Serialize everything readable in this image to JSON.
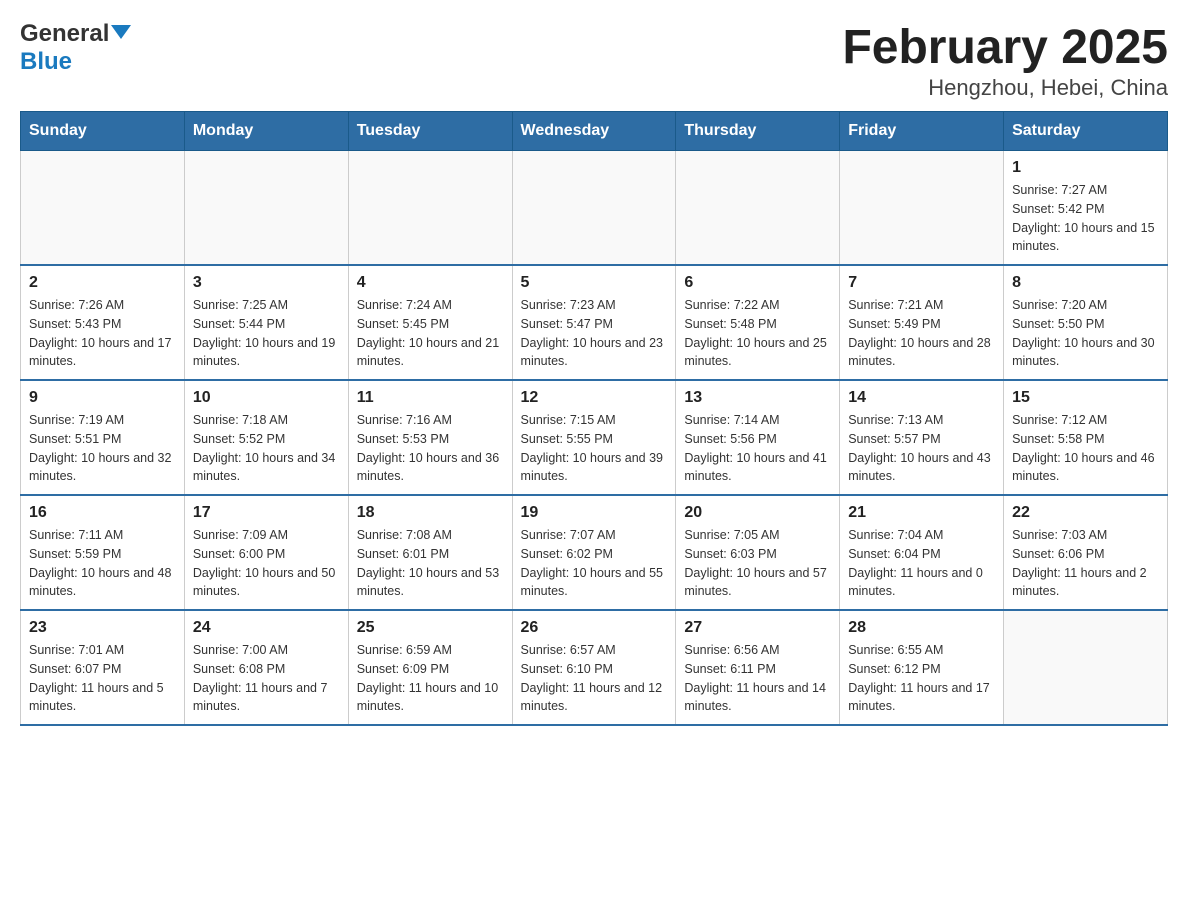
{
  "header": {
    "logo_general": "General",
    "logo_blue": "Blue",
    "month_title": "February 2025",
    "location": "Hengzhou, Hebei, China"
  },
  "weekdays": [
    "Sunday",
    "Monday",
    "Tuesday",
    "Wednesday",
    "Thursday",
    "Friday",
    "Saturday"
  ],
  "weeks": [
    [
      {
        "day": "",
        "info": ""
      },
      {
        "day": "",
        "info": ""
      },
      {
        "day": "",
        "info": ""
      },
      {
        "day": "",
        "info": ""
      },
      {
        "day": "",
        "info": ""
      },
      {
        "day": "",
        "info": ""
      },
      {
        "day": "1",
        "info": "Sunrise: 7:27 AM\nSunset: 5:42 PM\nDaylight: 10 hours and 15 minutes."
      }
    ],
    [
      {
        "day": "2",
        "info": "Sunrise: 7:26 AM\nSunset: 5:43 PM\nDaylight: 10 hours and 17 minutes."
      },
      {
        "day": "3",
        "info": "Sunrise: 7:25 AM\nSunset: 5:44 PM\nDaylight: 10 hours and 19 minutes."
      },
      {
        "day": "4",
        "info": "Sunrise: 7:24 AM\nSunset: 5:45 PM\nDaylight: 10 hours and 21 minutes."
      },
      {
        "day": "5",
        "info": "Sunrise: 7:23 AM\nSunset: 5:47 PM\nDaylight: 10 hours and 23 minutes."
      },
      {
        "day": "6",
        "info": "Sunrise: 7:22 AM\nSunset: 5:48 PM\nDaylight: 10 hours and 25 minutes."
      },
      {
        "day": "7",
        "info": "Sunrise: 7:21 AM\nSunset: 5:49 PM\nDaylight: 10 hours and 28 minutes."
      },
      {
        "day": "8",
        "info": "Sunrise: 7:20 AM\nSunset: 5:50 PM\nDaylight: 10 hours and 30 minutes."
      }
    ],
    [
      {
        "day": "9",
        "info": "Sunrise: 7:19 AM\nSunset: 5:51 PM\nDaylight: 10 hours and 32 minutes."
      },
      {
        "day": "10",
        "info": "Sunrise: 7:18 AM\nSunset: 5:52 PM\nDaylight: 10 hours and 34 minutes."
      },
      {
        "day": "11",
        "info": "Sunrise: 7:16 AM\nSunset: 5:53 PM\nDaylight: 10 hours and 36 minutes."
      },
      {
        "day": "12",
        "info": "Sunrise: 7:15 AM\nSunset: 5:55 PM\nDaylight: 10 hours and 39 minutes."
      },
      {
        "day": "13",
        "info": "Sunrise: 7:14 AM\nSunset: 5:56 PM\nDaylight: 10 hours and 41 minutes."
      },
      {
        "day": "14",
        "info": "Sunrise: 7:13 AM\nSunset: 5:57 PM\nDaylight: 10 hours and 43 minutes."
      },
      {
        "day": "15",
        "info": "Sunrise: 7:12 AM\nSunset: 5:58 PM\nDaylight: 10 hours and 46 minutes."
      }
    ],
    [
      {
        "day": "16",
        "info": "Sunrise: 7:11 AM\nSunset: 5:59 PM\nDaylight: 10 hours and 48 minutes."
      },
      {
        "day": "17",
        "info": "Sunrise: 7:09 AM\nSunset: 6:00 PM\nDaylight: 10 hours and 50 minutes."
      },
      {
        "day": "18",
        "info": "Sunrise: 7:08 AM\nSunset: 6:01 PM\nDaylight: 10 hours and 53 minutes."
      },
      {
        "day": "19",
        "info": "Sunrise: 7:07 AM\nSunset: 6:02 PM\nDaylight: 10 hours and 55 minutes."
      },
      {
        "day": "20",
        "info": "Sunrise: 7:05 AM\nSunset: 6:03 PM\nDaylight: 10 hours and 57 minutes."
      },
      {
        "day": "21",
        "info": "Sunrise: 7:04 AM\nSunset: 6:04 PM\nDaylight: 11 hours and 0 minutes."
      },
      {
        "day": "22",
        "info": "Sunrise: 7:03 AM\nSunset: 6:06 PM\nDaylight: 11 hours and 2 minutes."
      }
    ],
    [
      {
        "day": "23",
        "info": "Sunrise: 7:01 AM\nSunset: 6:07 PM\nDaylight: 11 hours and 5 minutes."
      },
      {
        "day": "24",
        "info": "Sunrise: 7:00 AM\nSunset: 6:08 PM\nDaylight: 11 hours and 7 minutes."
      },
      {
        "day": "25",
        "info": "Sunrise: 6:59 AM\nSunset: 6:09 PM\nDaylight: 11 hours and 10 minutes."
      },
      {
        "day": "26",
        "info": "Sunrise: 6:57 AM\nSunset: 6:10 PM\nDaylight: 11 hours and 12 minutes."
      },
      {
        "day": "27",
        "info": "Sunrise: 6:56 AM\nSunset: 6:11 PM\nDaylight: 11 hours and 14 minutes."
      },
      {
        "day": "28",
        "info": "Sunrise: 6:55 AM\nSunset: 6:12 PM\nDaylight: 11 hours and 17 minutes."
      },
      {
        "day": "",
        "info": ""
      }
    ]
  ]
}
